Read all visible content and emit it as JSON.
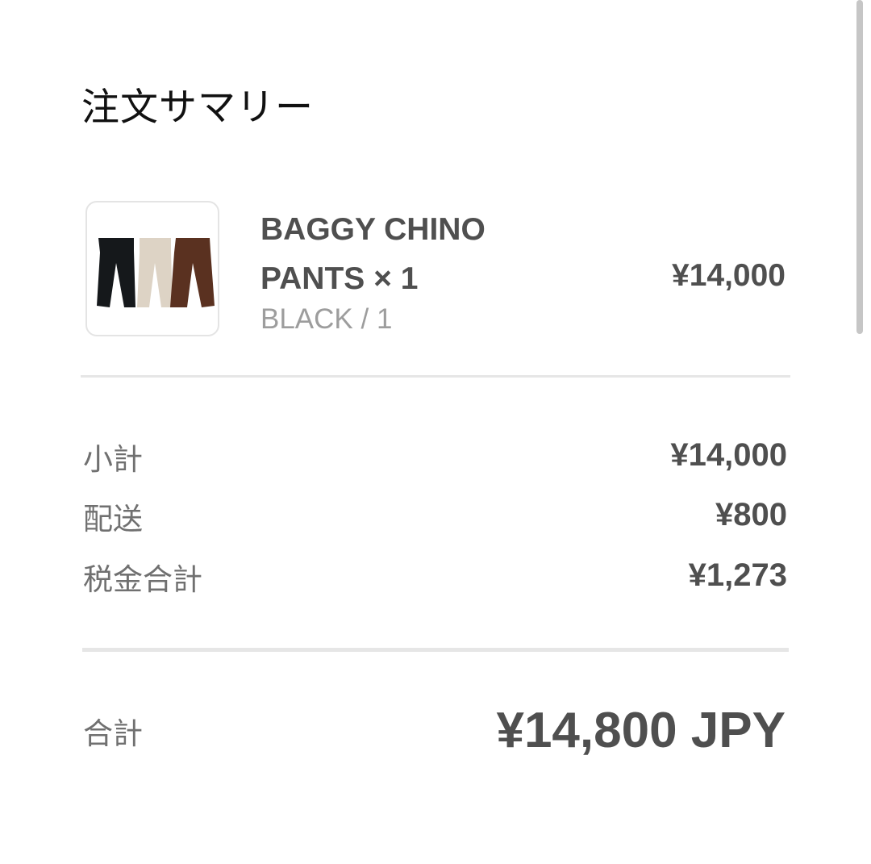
{
  "summary": {
    "title": "注文サマリー"
  },
  "item": {
    "name": "BAGGY CHINO PANTS × 1",
    "variant": "BLACK / 1",
    "price": "¥14,000",
    "image_colors": [
      "#15181b",
      "#ddd3c5",
      "#5a3120"
    ]
  },
  "breakdown": [
    {
      "label": "小計",
      "value": "¥14,000"
    },
    {
      "label": "配送",
      "value": "¥800"
    },
    {
      "label": "税金合計",
      "value": "¥1,273"
    }
  ],
  "total": {
    "label": "合計",
    "value": "¥14,800 JPY"
  }
}
